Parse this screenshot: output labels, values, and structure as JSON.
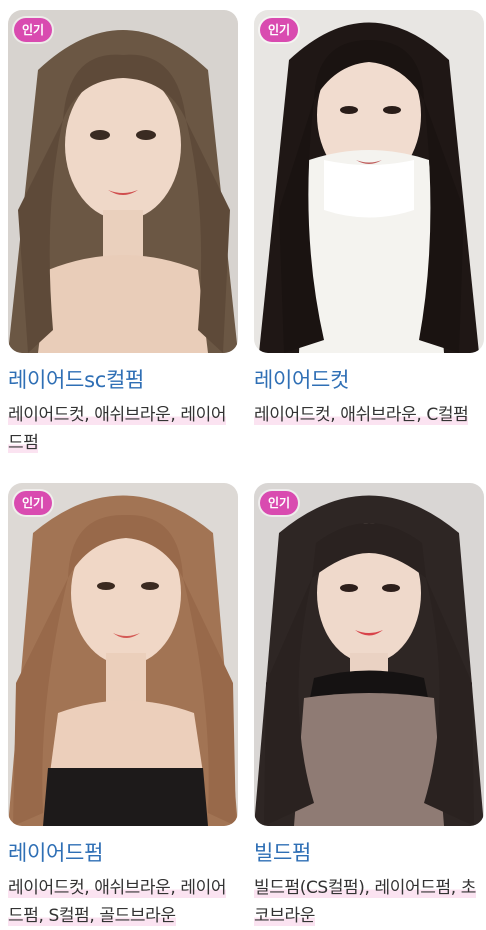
{
  "colors": {
    "accent_title": "#2f6fb5",
    "badge_bg": "#d94bb0",
    "tag_highlight": "#fbe3f1"
  },
  "cards": [
    {
      "badge": "인기",
      "title": "레이어드sc컬펌",
      "tags": "레이어드컷, 애쉬브라운, 레이어드펌",
      "image_icon": "portrait-photo-icon"
    },
    {
      "badge": "인기",
      "title": "레이어드컷",
      "tags": "레이어드컷, 애쉬브라운, C컬펌",
      "image_icon": "portrait-photo-icon"
    },
    {
      "badge": "인기",
      "title": "레이어드펌",
      "tags": "레이어드컷, 애쉬브라운, 레이어드펌, S컬펌, 골드브라운",
      "image_icon": "portrait-photo-icon"
    },
    {
      "badge": "인기",
      "title": "빌드펌",
      "tags": "빌드펌(CS컬펌), 레이어드펌, 초코브라운",
      "image_icon": "portrait-photo-icon"
    }
  ]
}
